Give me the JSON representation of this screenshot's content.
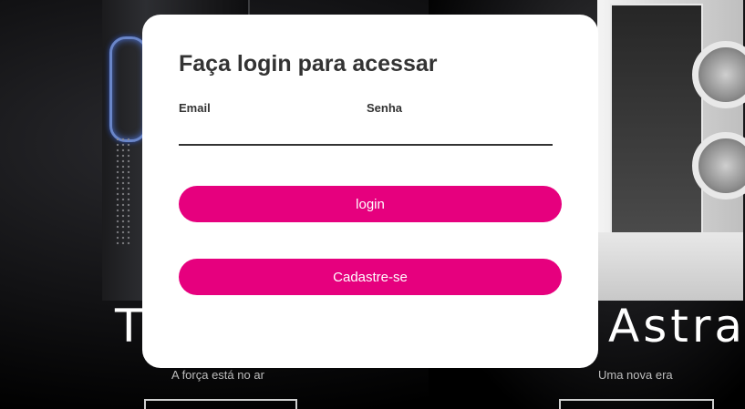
{
  "modal": {
    "title": "Faça login para acessar",
    "email_label": "Email",
    "password_label": "Senha",
    "email_value": "",
    "password_value": "",
    "login_label": "login",
    "signup_label": "Cadastre-se"
  },
  "background": {
    "left_title": "T",
    "left_subtitle": "A força está no ar",
    "right_title": "Astra",
    "right_subtitle": "Uma nova era"
  },
  "colors": {
    "accent": "#e6007e",
    "modal_bg": "#ffffff",
    "text": "#333333"
  }
}
